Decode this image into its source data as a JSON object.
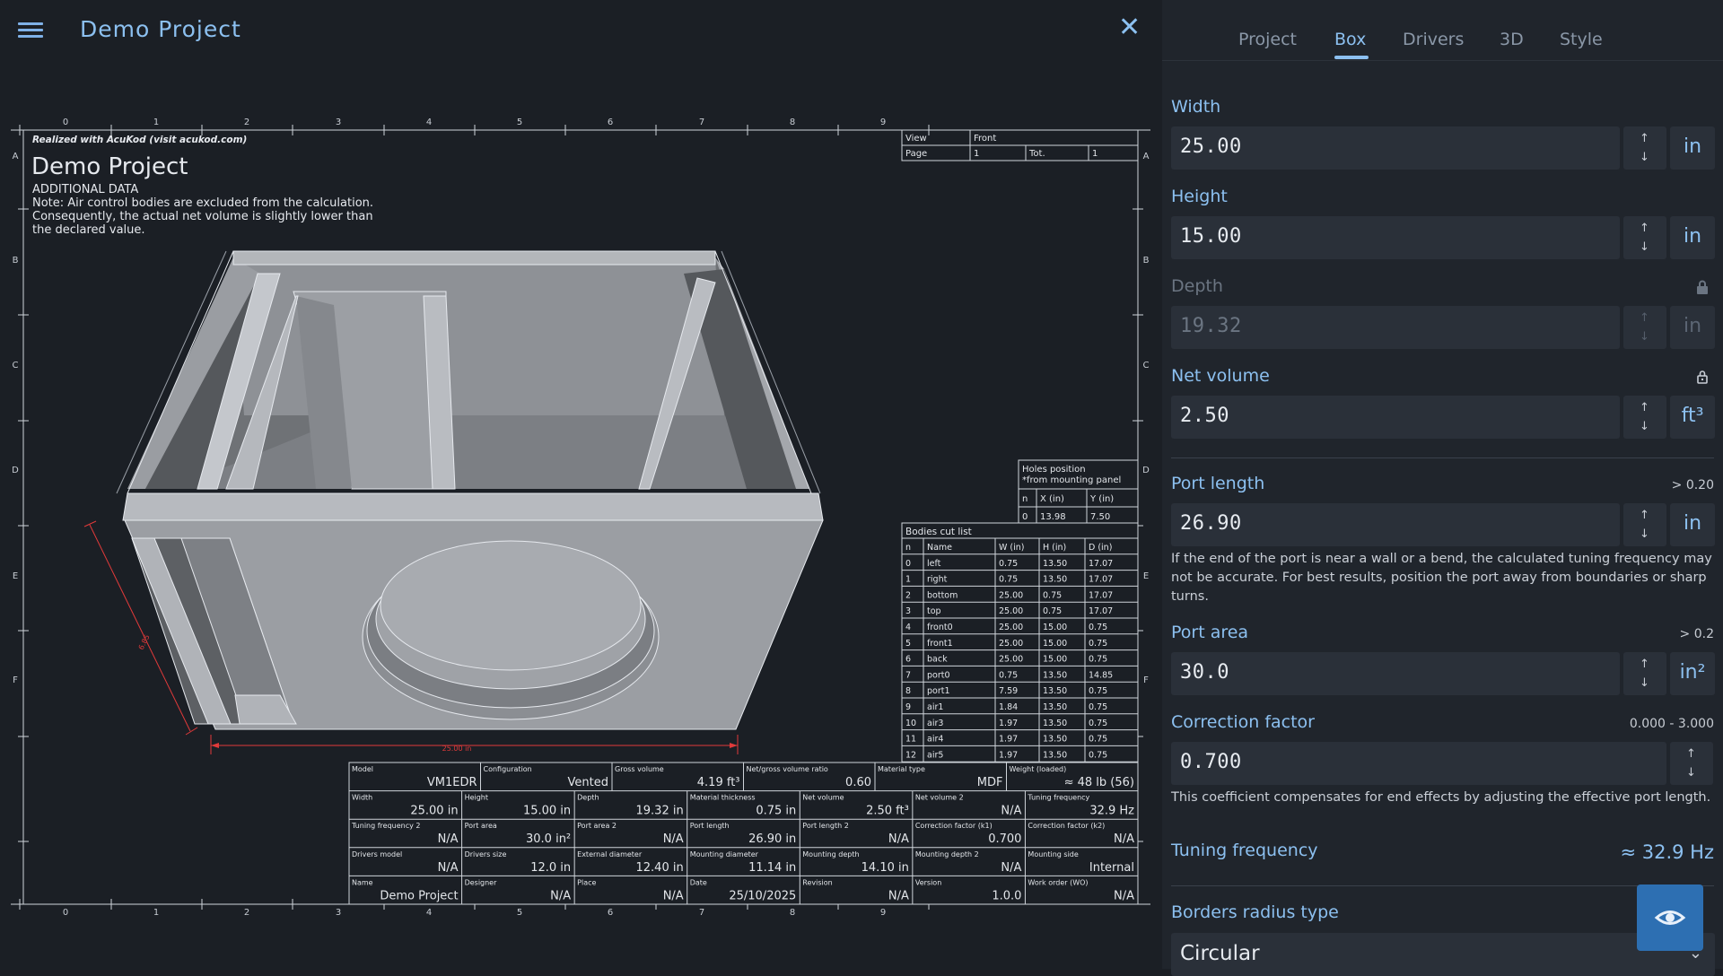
{
  "header": {
    "title": "Demo Project"
  },
  "tabs": [
    {
      "label": "Project"
    },
    {
      "label": "Box"
    },
    {
      "label": "Drivers"
    },
    {
      "label": "3D"
    },
    {
      "label": "Style"
    }
  ],
  "ruler": {
    "columns": [
      "0",
      "1",
      "2",
      "3",
      "4",
      "5",
      "6",
      "7",
      "8",
      "9"
    ],
    "rows": [
      "A",
      "B",
      "C",
      "D",
      "E",
      "F"
    ]
  },
  "drawing": {
    "watermark": "Realized with AcuKod (visit acukod.com)",
    "title": "Demo Project",
    "additional": "ADDITIONAL DATA",
    "note_lines": [
      "Note: Air control bodies are excluded from the calculation.",
      "Consequently, the actual net volume is slightly lower than",
      "the declared value."
    ],
    "dim_width": "25.00 in",
    "dim_depth": "6.85"
  },
  "view_table": {
    "view_label": "View",
    "view_value": "Front",
    "page_label": "Page",
    "page_value": "1",
    "tot_label": "Tot.",
    "tot_value": "1"
  },
  "holes": {
    "title1": "Holes position",
    "title2": "*from mounting panel",
    "headers": [
      "n",
      "X (in)",
      "Y (in)"
    ],
    "rows": [
      [
        "0",
        "13.98",
        "7.50"
      ]
    ]
  },
  "cut_list": {
    "title": "Bodies cut list",
    "headers": [
      "n",
      "Name",
      "W (in)",
      "H (in)",
      "D (in)"
    ],
    "rows": [
      [
        "0",
        "left",
        "0.75",
        "13.50",
        "17.07"
      ],
      [
        "1",
        "right",
        "0.75",
        "13.50",
        "17.07"
      ],
      [
        "2",
        "bottom",
        "25.00",
        "0.75",
        "17.07"
      ],
      [
        "3",
        "top",
        "25.00",
        "0.75",
        "17.07"
      ],
      [
        "4",
        "front0",
        "25.00",
        "15.00",
        "0.75"
      ],
      [
        "5",
        "front1",
        "25.00",
        "15.00",
        "0.75"
      ],
      [
        "6",
        "back",
        "25.00",
        "15.00",
        "0.75"
      ],
      [
        "7",
        "port0",
        "0.75",
        "13.50",
        "14.85"
      ],
      [
        "8",
        "port1",
        "7.59",
        "13.50",
        "0.75"
      ],
      [
        "9",
        "air1",
        "1.84",
        "13.50",
        "0.75"
      ],
      [
        "10",
        "air3",
        "1.97",
        "13.50",
        "0.75"
      ],
      [
        "11",
        "air4",
        "1.97",
        "13.50",
        "0.75"
      ],
      [
        "12",
        "air5",
        "1.97",
        "13.50",
        "0.75"
      ]
    ]
  },
  "spec_table": {
    "rows": [
      [
        [
          "Model",
          "VM1EDR"
        ],
        [
          "Configuration",
          "Vented"
        ],
        [
          "Gross volume",
          "4.19 ft³"
        ],
        [
          "Net/gross volume ratio",
          "0.60"
        ],
        [
          "Material type",
          "MDF"
        ],
        [
          "Weight (loaded)",
          "≈ 48 lb (56)"
        ]
      ],
      [
        [
          "Width",
          "25.00 in"
        ],
        [
          "Height",
          "15.00 in"
        ],
        [
          "Depth",
          "19.32 in"
        ],
        [
          "Material thickness",
          "0.75 in"
        ],
        [
          "Net volume",
          "2.50 ft³"
        ],
        [
          "Net volume 2",
          "N/A"
        ],
        [
          "Tuning frequency",
          "32.9 Hz"
        ]
      ],
      [
        [
          "Tuning frequency 2",
          "N/A"
        ],
        [
          "Port area",
          "30.0 in²"
        ],
        [
          "Port area 2",
          "N/A"
        ],
        [
          "Port length",
          "26.90 in"
        ],
        [
          "Port length 2",
          "N/A"
        ],
        [
          "Correction factor (k1)",
          "0.700"
        ],
        [
          "Correction factor (k2)",
          "N/A"
        ]
      ],
      [
        [
          "Drivers model",
          "N/A"
        ],
        [
          "Drivers size",
          "12.0 in"
        ],
        [
          "External diameter",
          "12.40 in"
        ],
        [
          "Mounting diameter",
          "11.14 in"
        ],
        [
          "Mounting depth",
          "14.10 in"
        ],
        [
          "Mounting depth 2",
          "N/A"
        ],
        [
          "Mounting side",
          "Internal"
        ]
      ],
      [
        [
          "Name",
          "Demo Project"
        ],
        [
          "Designer",
          "N/A"
        ],
        [
          "Place",
          "N/A"
        ],
        [
          "Date",
          "25/10/2025"
        ],
        [
          "Revision",
          "N/A"
        ],
        [
          "Version",
          "1.0.0"
        ],
        [
          "Work order (WO)",
          "N/A"
        ]
      ]
    ]
  },
  "box_form": {
    "width": {
      "label": "Width",
      "value": "25.00",
      "unit": "in"
    },
    "height": {
      "label": "Height",
      "value": "15.00",
      "unit": "in"
    },
    "depth": {
      "label": "Depth",
      "value": "19.32",
      "unit": "in"
    },
    "net_volume": {
      "label": "Net volume",
      "value": "2.50",
      "unit": "ft³"
    },
    "port_length": {
      "label": "Port length",
      "hint": "> 0.20",
      "value": "26.90",
      "unit": "in",
      "note": "If the end of the port is near a wall or a bend, the calculated tuning frequency may not be accurate. For best results, position the port away from boundaries or sharp turns."
    },
    "port_area": {
      "label": "Port area",
      "hint": "> 0.2",
      "value": "30.0",
      "unit": "in²"
    },
    "correction": {
      "label": "Correction factor",
      "hint": "0.000 - 3.000",
      "value": "0.700",
      "note": "This coefficient compensates for end effects by adjusting the effective port length."
    },
    "tuning": {
      "label": "Tuning frequency",
      "value": "≈ 32.9 Hz"
    },
    "borders": {
      "label": "Borders radius type",
      "value": "Circular"
    }
  },
  "colors": {
    "accent": "#8cc0f0",
    "dimension": "#e03a3a",
    "fab": "#2d6fb2"
  },
  "icons": [
    "menu-icon",
    "close-icon",
    "lock-icon",
    "arrow-up-icon",
    "arrow-down-icon",
    "chevron-down-icon",
    "eye-icon"
  ]
}
